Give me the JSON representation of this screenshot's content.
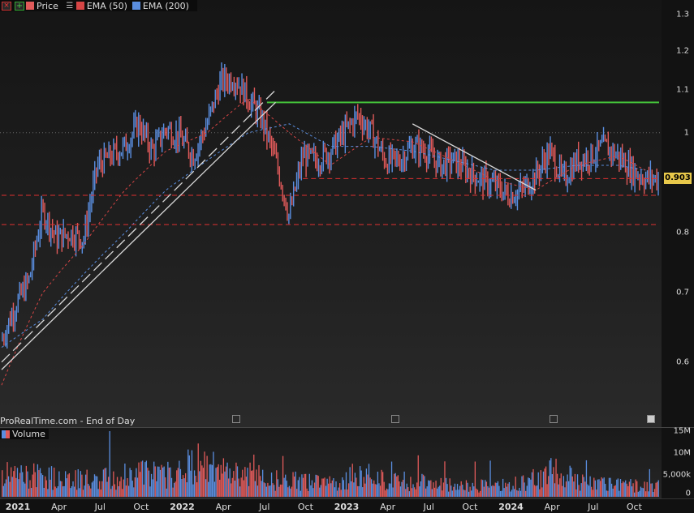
{
  "legend": {
    "items": [
      {
        "label": "Price",
        "color": "#e05a5a"
      },
      {
        "label": "EMA (50)",
        "color": "#d64545"
      },
      {
        "label": "EMA (200)",
        "color": "#5a8ee0"
      }
    ]
  },
  "source_text": "ProRealTime.com - End of Day",
  "volume_legend": "Volume",
  "current_price_tag": "0.903",
  "colors": {
    "up": "#5a8ee0",
    "down": "#e05a5a",
    "resistance": "#44c23a",
    "support": "#e03030",
    "trendline": "#d8d8d8",
    "tag": "#e8c84a"
  },
  "icons": [
    "close-icon",
    "add-icon",
    "list-icon",
    "calendar-icon",
    "info-icon"
  ],
  "chart_data": [
    {
      "type": "line",
      "title": "",
      "scale": "log",
      "ylim": [
        0.55,
        1.32
      ],
      "y_ticks": [
        "1.3",
        "1.2",
        "1.1",
        "1",
        "0.9",
        "0.8",
        "0.7",
        "0.6"
      ],
      "x_ticks": [
        "2021",
        "Apr",
        "Jul",
        "Oct",
        "2022",
        "Apr",
        "Jul",
        "Oct",
        "2023",
        "Apr",
        "Jul",
        "Oct",
        "2024",
        "Apr",
        "Jul",
        "Oct"
      ],
      "x_range": [
        "2021-01",
        "2024-12"
      ],
      "series": [
        {
          "name": "Price",
          "x": [
            "2021-01",
            "2021-02",
            "2021-03",
            "2021-04",
            "2021-05",
            "2021-06",
            "2021-07",
            "2021-08",
            "2021-09",
            "2021-10",
            "2021-11",
            "2021-12",
            "2022-01",
            "2022-02",
            "2022-03",
            "2022-04",
            "2022-05",
            "2022-06",
            "2022-07",
            "2022-08",
            "2022-09",
            "2022-10",
            "2022-11",
            "2022-12",
            "2023-01",
            "2023-02",
            "2023-03",
            "2023-04",
            "2023-05",
            "2023-06",
            "2023-07",
            "2023-08",
            "2023-09",
            "2023-10",
            "2023-11",
            "2023-12",
            "2024-01",
            "2024-02",
            "2024-03",
            "2024-04",
            "2024-05",
            "2024-06",
            "2024-07",
            "2024-08",
            "2024-09",
            "2024-10",
            "2024-11",
            "2024-12"
          ],
          "values": [
            0.63,
            0.68,
            0.72,
            0.84,
            0.79,
            0.8,
            0.79,
            0.93,
            0.95,
            0.97,
            1.02,
            0.96,
            1.01,
            0.99,
            0.95,
            1.02,
            1.12,
            1.13,
            1.08,
            1.03,
            0.94,
            0.83,
            0.95,
            0.94,
            0.96,
            1.0,
            1.04,
            1.0,
            0.94,
            0.94,
            0.97,
            0.96,
            0.93,
            0.94,
            0.92,
            0.9,
            0.89,
            0.87,
            0.88,
            0.91,
            0.96,
            0.9,
            0.94,
            0.95,
            0.97,
            0.95,
            0.92,
            0.903
          ]
        },
        {
          "name": "EMA (50)",
          "x": [
            "2021-01",
            "2021-04",
            "2021-07",
            "2021-10",
            "2022-01",
            "2022-04",
            "2022-07",
            "2022-10",
            "2023-01",
            "2023-04",
            "2023-07",
            "2023-10",
            "2024-01",
            "2024-04",
            "2024-07",
            "2024-10",
            "2024-12"
          ],
          "values": [
            0.57,
            0.7,
            0.78,
            0.88,
            0.96,
            1.0,
            1.08,
            1.0,
            0.93,
            0.99,
            0.98,
            0.94,
            0.9,
            0.88,
            0.93,
            0.95,
            0.92
          ]
        },
        {
          "name": "EMA (200)",
          "x": [
            "2021-01",
            "2021-04",
            "2021-07",
            "2021-10",
            "2022-01",
            "2022-04",
            "2022-07",
            "2022-10",
            "2023-01",
            "2023-04",
            "2023-07",
            "2023-10",
            "2024-01",
            "2024-04",
            "2024-07",
            "2024-10",
            "2024-12"
          ],
          "values": [
            0.62,
            0.66,
            0.73,
            0.8,
            0.88,
            0.94,
            1.0,
            1.02,
            0.97,
            0.97,
            0.96,
            0.94,
            0.92,
            0.92,
            0.93,
            0.93,
            0.92
          ]
        }
      ],
      "levels": [
        {
          "kind": "resistance",
          "value": 1.07,
          "from": "2021-10",
          "to": "2024-12"
        },
        {
          "kind": "support",
          "value": 0.903,
          "from": "2022-11",
          "to": "2024-12"
        },
        {
          "kind": "support",
          "value": 0.87,
          "from": "2021-01",
          "to": "2024-12"
        },
        {
          "kind": "support",
          "value": 0.815,
          "from": "2021-01",
          "to": "2024-12"
        }
      ],
      "trendlines": [
        {
          "from": [
            "2021-01",
            0.59
          ],
          "to": [
            "2022-09",
            1.07
          ],
          "style": "solid"
        },
        {
          "from": [
            "2021-01",
            0.6
          ],
          "to": [
            "2022-09",
            1.1
          ],
          "style": "dashed"
        },
        {
          "from": [
            "2023-07",
            1.02
          ],
          "to": [
            "2024-04",
            0.88
          ],
          "style": "solid"
        }
      ],
      "current_price": 0.903
    },
    {
      "type": "bar",
      "title": "Volume",
      "y_ticks": [
        "15M",
        "10M",
        "5,000k",
        "0"
      ],
      "ylim": [
        0,
        15000000
      ],
      "x": [
        "2021-01",
        "2021-03",
        "2021-05",
        "2021-07",
        "2021-09",
        "2021-11",
        "2022-01",
        "2022-03",
        "2022-05",
        "2022-07",
        "2022-09",
        "2022-11",
        "2023-01",
        "2023-03",
        "2023-05",
        "2023-07",
        "2023-09",
        "2023-11",
        "2024-01",
        "2024-03",
        "2024-05",
        "2024-07",
        "2024-09",
        "2024-11"
      ],
      "values": [
        6000000,
        5500000,
        5000000,
        4500000,
        5000000,
        6500000,
        5500000,
        9000000,
        7000000,
        6000000,
        4500000,
        4000000,
        3500000,
        6000000,
        4500000,
        4000000,
        3500000,
        3000000,
        2800000,
        3500000,
        7000000,
        4500000,
        3500000,
        3000000
      ]
    }
  ]
}
